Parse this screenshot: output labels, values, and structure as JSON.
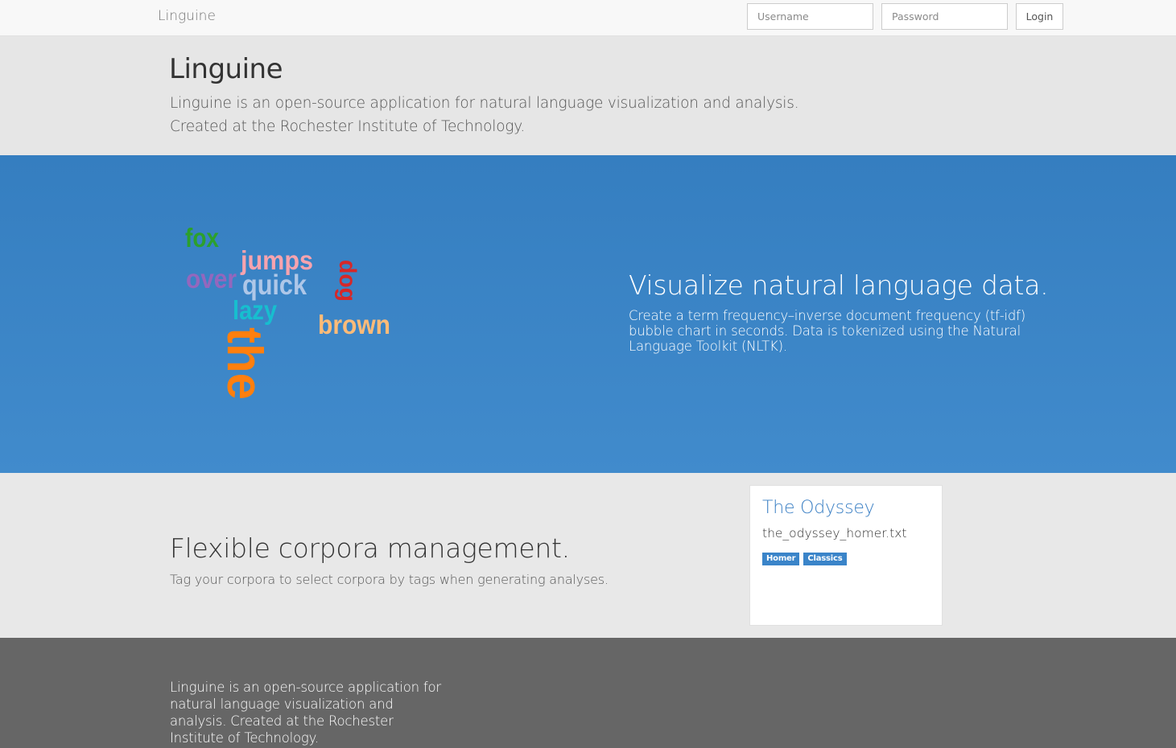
{
  "navbar": {
    "brand": "Linguine",
    "username_placeholder": "Username",
    "password_placeholder": "Password",
    "login_label": "Login"
  },
  "intro": {
    "title": "Linguine",
    "line1": "Linguine is an open-source application for natural language visualization and analysis.",
    "line2": "Created at the Rochester Institute of Technology."
  },
  "visualize": {
    "heading": "Visualize natural language data.",
    "description": "Create a term frequency–inverse document frequency (tf-idf) bubble chart in seconds. Data is tokenized using the Natural Language Toolkit (NLTK).",
    "wordcloud": [
      {
        "word": "fox",
        "color": "#2ca02c",
        "rotated": false
      },
      {
        "word": "jumps",
        "color": "#f7a3ae",
        "rotated": false
      },
      {
        "word": "over",
        "color": "#9467bd",
        "rotated": false
      },
      {
        "word": "quick",
        "color": "#aec7e8",
        "rotated": false
      },
      {
        "word": "dog",
        "color": "#d62728",
        "rotated": true
      },
      {
        "word": "lazy",
        "color": "#17becf",
        "rotated": false
      },
      {
        "word": "brown",
        "color": "#ffbb78",
        "rotated": false
      },
      {
        "word": "the",
        "color": "#ff7f0e",
        "rotated": true
      }
    ]
  },
  "corpora": {
    "heading": "Flexible corpora management.",
    "description": "Tag your corpora to select corpora by tags when generating analyses.",
    "card": {
      "title": "The Odyssey",
      "filename": "the_odyssey_homer.txt",
      "tags": [
        "Homer",
        "Classics"
      ]
    }
  },
  "footer": {
    "text": "Linguine is an open-source application for natural language visualization and analysis. Created at the Rochester Institute of Technology."
  }
}
